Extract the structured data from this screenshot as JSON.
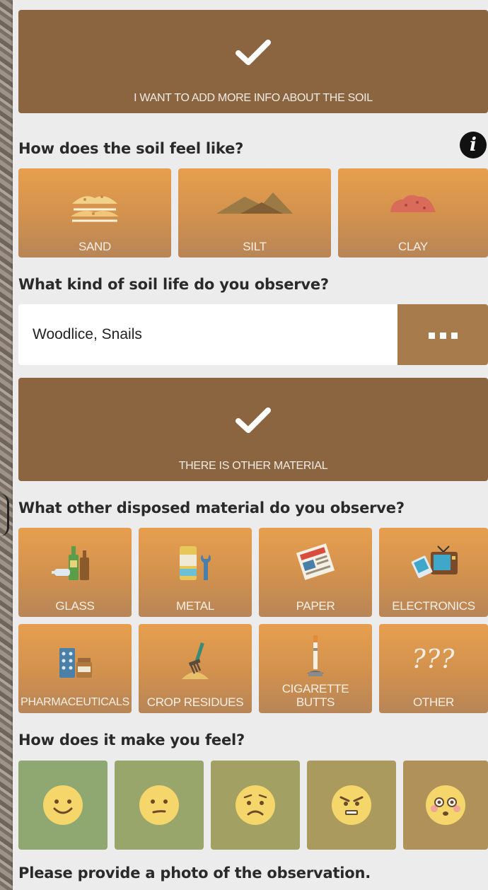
{
  "soil_info_toggle": {
    "label": "I WANT TO ADD MORE INFO ABOUT THE SOIL"
  },
  "soil_feel": {
    "question": "How does the soil feel like?",
    "info_icon": "info-icon",
    "options": [
      {
        "label": "SAND",
        "icon": "sand-icon"
      },
      {
        "label": "SILT",
        "icon": "silt-icon"
      },
      {
        "label": "CLAY",
        "icon": "clay-icon"
      }
    ]
  },
  "soil_life": {
    "question": "What kind of soil life do you observe?",
    "value": "Woodlice, Snails",
    "more_icon": "more-options-icon"
  },
  "other_material_toggle": {
    "label": "THERE IS OTHER MATERIAL"
  },
  "disposed_material": {
    "question": "What other disposed material do you observe?",
    "options": [
      {
        "label": "GLASS",
        "icon": "glass-bottles-icon"
      },
      {
        "label": "METAL",
        "icon": "metal-can-wrench-icon"
      },
      {
        "label": "PAPER",
        "icon": "newspaper-icon"
      },
      {
        "label": "ELECTRONICS",
        "icon": "electronics-icon"
      },
      {
        "label": "PHARMACEUTICALS",
        "icon": "pills-icon"
      },
      {
        "label": "CROP RESIDUES",
        "icon": "pitchfork-hay-icon"
      },
      {
        "label": "CIGARETTE BUTTS",
        "icon": "cigarette-icon"
      },
      {
        "label": "OTHER",
        "icon": "question-marks-icon"
      }
    ]
  },
  "feeling": {
    "question": "How does it make you feel?",
    "moods": [
      {
        "icon": "smile-face-icon",
        "color": "#8fa872"
      },
      {
        "icon": "neutral-face-icon",
        "color": "#98a56b"
      },
      {
        "icon": "sad-face-icon",
        "color": "#a2a063"
      },
      {
        "icon": "angry-face-icon",
        "color": "#ab9a5e"
      },
      {
        "icon": "shocked-face-icon",
        "color": "#b0915a"
      }
    ]
  },
  "photo": {
    "prompt": "Please provide a photo of the observation."
  },
  "colors": {
    "toggle_bg": "#8b6440",
    "tile_orange": "#e79f4e",
    "panel_bg": "#ececec"
  }
}
